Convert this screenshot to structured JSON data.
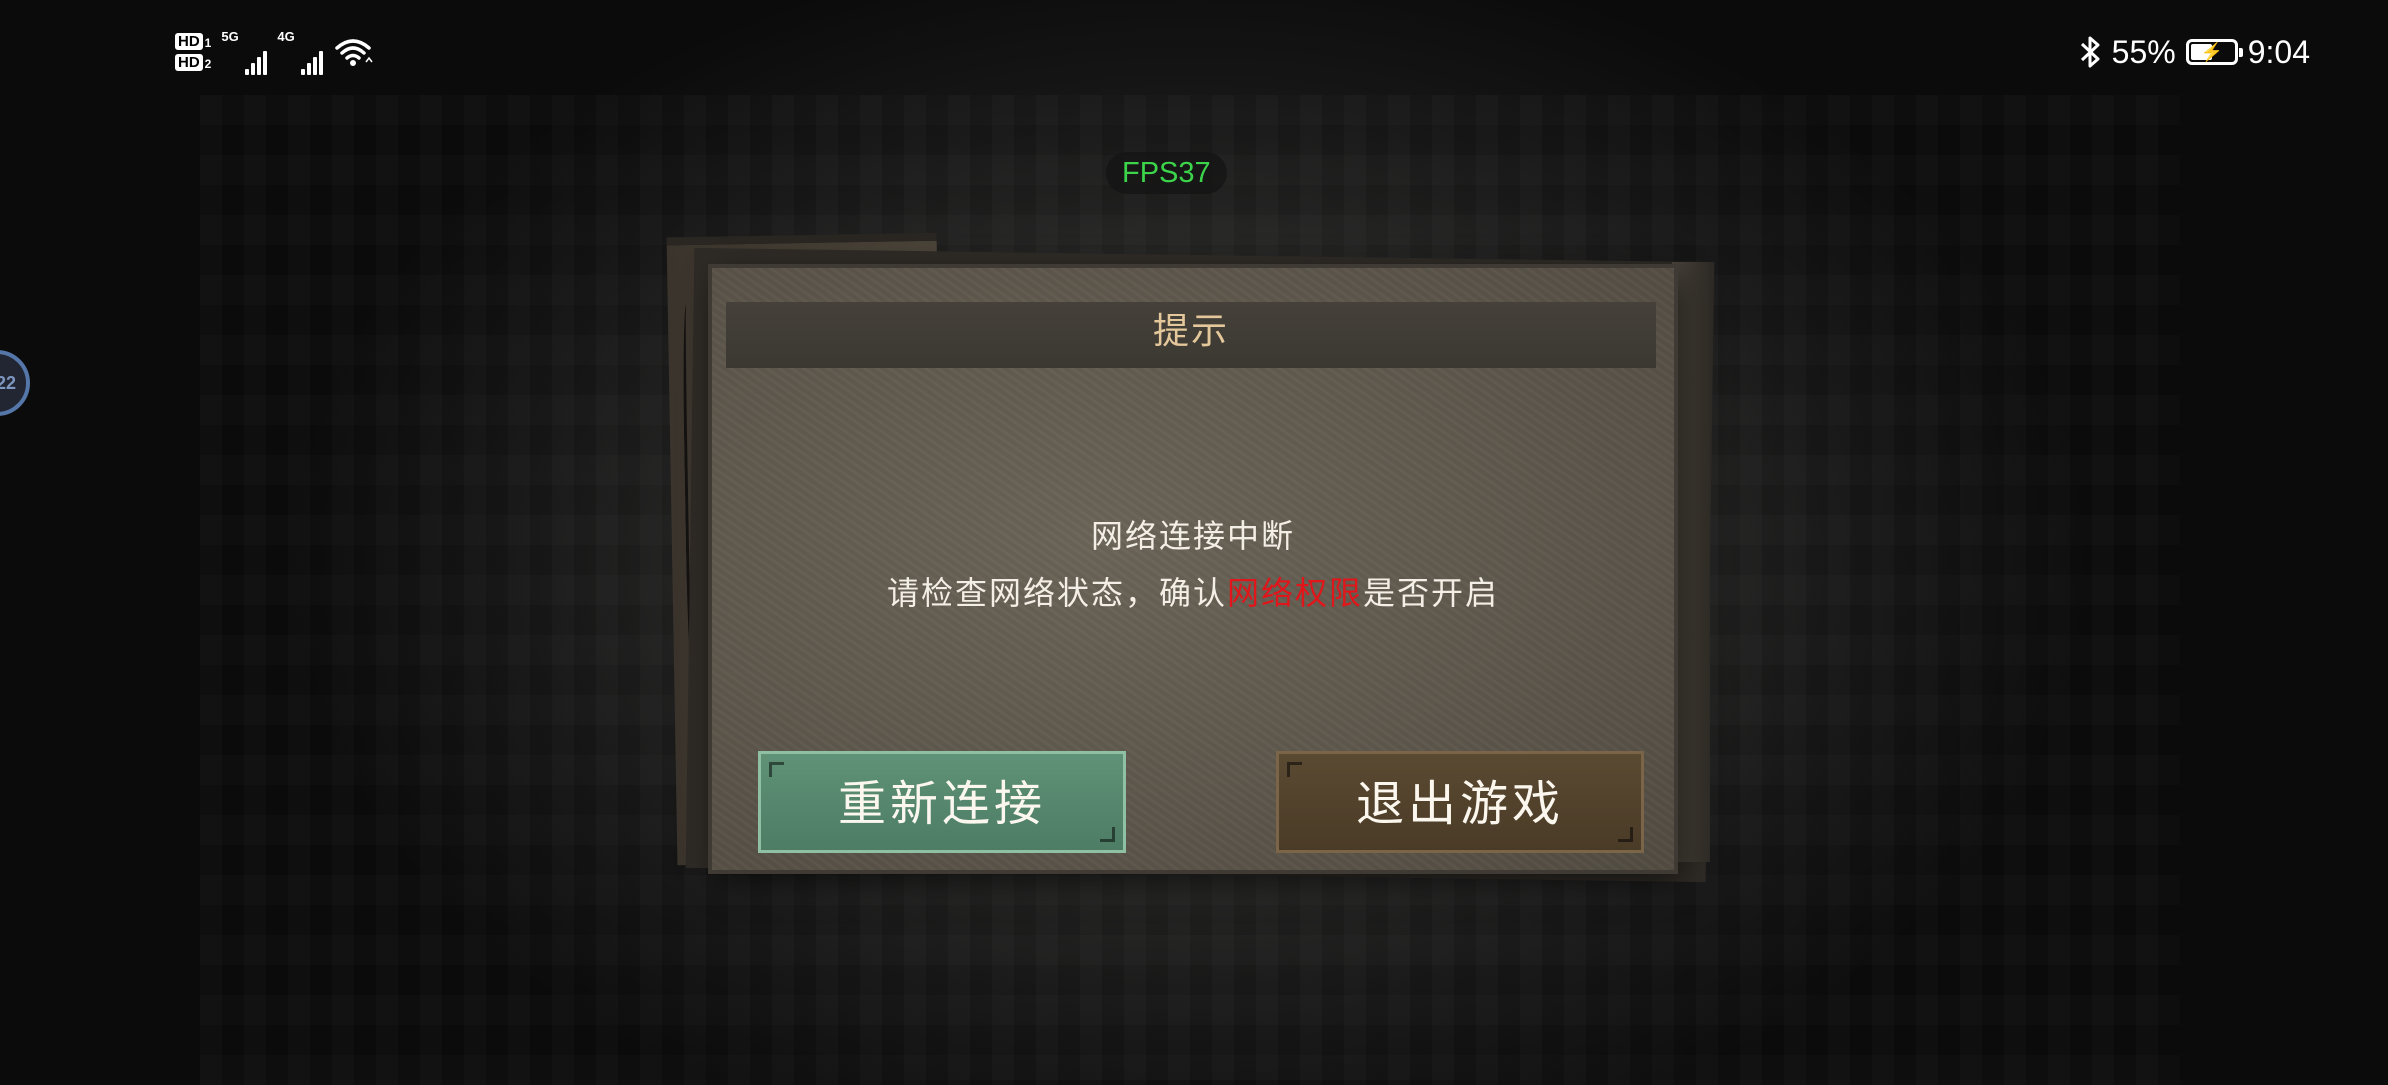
{
  "status_bar": {
    "sim1_label": "HD",
    "sim1_index": "1",
    "sim2_label": "HD",
    "sim2_index": "2",
    "network1": "5G",
    "network2": "4G",
    "battery_percent": "55%",
    "time": "9:04",
    "battery_level": 0.55
  },
  "overlay": {
    "fps": "FPS37",
    "bubble_text": "22"
  },
  "dialog": {
    "title": "提示",
    "message_line1": "网络连接中断",
    "message_line2_prefix": "请检查网络状态，确认",
    "message_line2_highlight": "网络权限",
    "message_line2_suffix": "是否开启",
    "reconnect_label": "重新连接",
    "exit_label": "退出游戏",
    "highlight_color": "#e0161a"
  }
}
